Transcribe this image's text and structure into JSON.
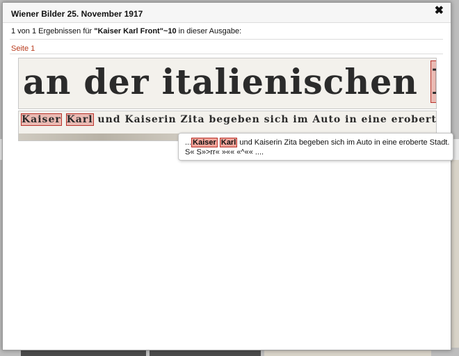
{
  "dialog": {
    "title": "Wiener Bilder 25. November 1917",
    "close_icon": "close-icon",
    "close_glyph": "✖",
    "summary_prefix": "1 von 1 Ergebnissen für ",
    "summary_query": "\"Kaiser Karl Front\"~10",
    "summary_suffix": " in dieser Ausgabe:",
    "page_link": "Seite 1"
  },
  "snippets": [
    {
      "text_before": "an der italienischen ",
      "text_hit": "Front",
      "text_after": "."
    },
    {
      "hit1": "Kaiser",
      "hit2": "Karl",
      "text_after": " und Kaiserin Zita begeben sich im Auto in eine eroberte Stadt."
    }
  ],
  "tooltip": {
    "prefix": "...",
    "hit1": "Kaiser",
    "hit2": "Karl",
    "rest": "und Kaiserin Zita begeben sich im Auto in eine eroberte Stadt.",
    "line2": "S« S»>rr« »«« «^«« ...."
  },
  "colors": {
    "highlight_border": "#b9322a",
    "highlight_fill": "#f2a59b",
    "link": "#b83a1c"
  }
}
